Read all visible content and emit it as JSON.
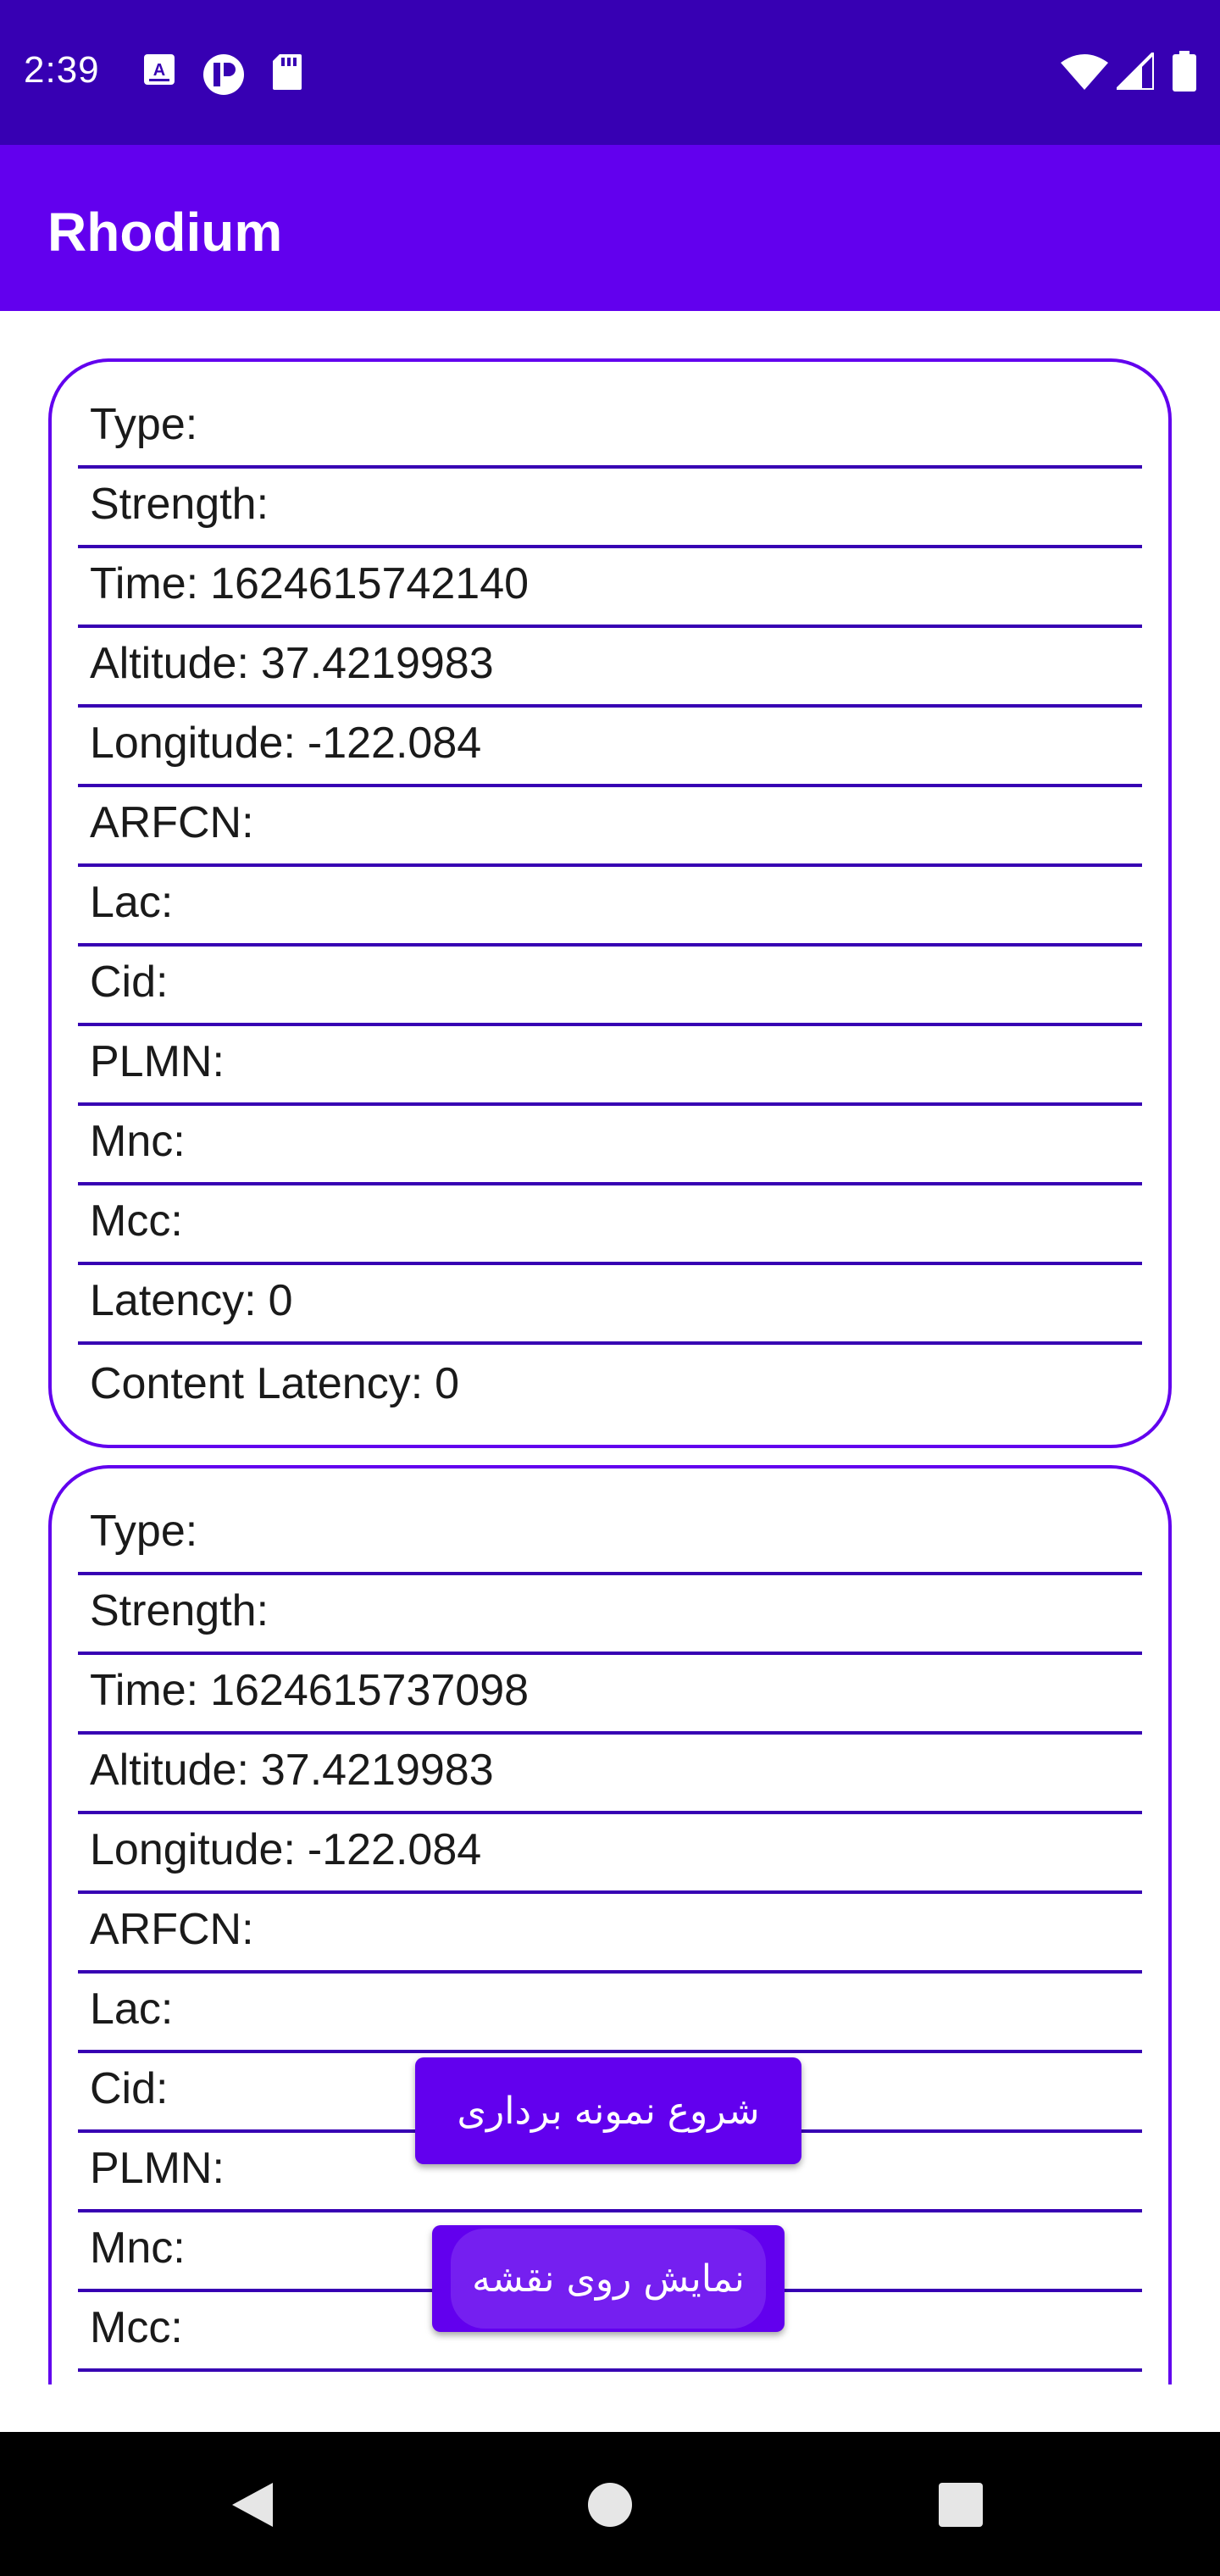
{
  "status_bar": {
    "time": "2:39",
    "icons": [
      "a-icon",
      "r-app-icon",
      "sd-card-icon",
      "wifi-icon",
      "signal-icon",
      "battery-icon"
    ]
  },
  "app_bar": {
    "title": "Rhodium"
  },
  "cards": [
    {
      "rows": [
        {
          "label": "Type:",
          "value": ""
        },
        {
          "label": "Strength:",
          "value": ""
        },
        {
          "label": "Time:",
          "value": "1624615742140"
        },
        {
          "label": "Altitude:",
          "value": "37.4219983"
        },
        {
          "label": "Longitude:",
          "value": "-122.084"
        },
        {
          "label": "ARFCN:",
          "value": ""
        },
        {
          "label": "Lac:",
          "value": ""
        },
        {
          "label": "Cid:",
          "value": ""
        },
        {
          "label": "PLMN:",
          "value": ""
        },
        {
          "label": "Mnc:",
          "value": ""
        },
        {
          "label": "Mcc:",
          "value": ""
        },
        {
          "label": "Latency:",
          "value": "0"
        },
        {
          "label": "Content Latency:",
          "value": "0"
        }
      ]
    },
    {
      "rows": [
        {
          "label": "Type:",
          "value": ""
        },
        {
          "label": "Strength:",
          "value": ""
        },
        {
          "label": "Time:",
          "value": "1624615737098"
        },
        {
          "label": "Altitude:",
          "value": "37.4219983"
        },
        {
          "label": "Longitude:",
          "value": "-122.084"
        },
        {
          "label": "ARFCN:",
          "value": ""
        },
        {
          "label": "Lac:",
          "value": ""
        },
        {
          "label": "Cid:",
          "value": ""
        },
        {
          "label": "PLMN:",
          "value": ""
        },
        {
          "label": "Mnc:",
          "value": ""
        },
        {
          "label": "Mcc:",
          "value": ""
        }
      ]
    }
  ],
  "buttons": {
    "start_sampling": "شروع نمونه برداری",
    "show_on_map": "نمایش روی نقشه"
  },
  "colors": {
    "status_bar": "#3700b3",
    "app_bar": "#6200ee",
    "accent": "#6200ee",
    "divider": "#3700b3",
    "nav_bar": "#000000"
  },
  "nav_bar": {
    "icons": [
      "back-icon",
      "home-icon",
      "recents-icon"
    ]
  }
}
